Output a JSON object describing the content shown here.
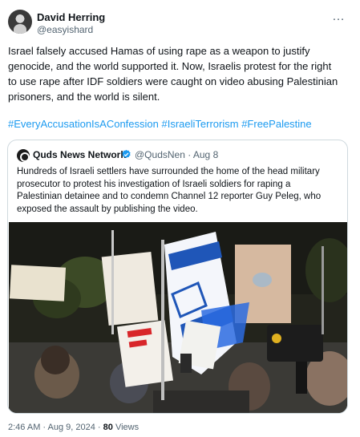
{
  "author": {
    "name": "David Herring",
    "handle": "@easyishard",
    "more_icon": "…"
  },
  "tweet": {
    "lines": [
      "Israel falsely accused Hamas of using rape as a weapon to justify",
      "genocide, and the world supported it. Now, Israelis protest for the right",
      "to use rape after IDF soldiers were caught on video abusing Palestinian",
      "prisoners, and the world is silent."
    ],
    "hashtags": [
      "#EveryAccusationIsAConfession",
      "#IsraeliTerrorism",
      "#FreePalestine"
    ]
  },
  "quote": {
    "name": "Quds News Network",
    "handle_date": "@QudsNen · Aug 8",
    "lines": [
      "Hundreds of Israeli settlers have surrounded the home of the head military",
      "prosecutor to protest his investigation of Israeli soldiers for raping a",
      "Palestinian detainee and to condemn Channel 12 reporter Guy Peleg, who",
      "exposed the assault by publishing the video."
    ],
    "verified_color": "#1d9bf0"
  },
  "meta": {
    "timestamp": "2:46 AM · Aug 9, 2024 · ",
    "views_count": "80",
    "views_label": " Views"
  },
  "colors": {
    "link": "#1d9bf0",
    "secondary_text": "#536471",
    "border": "#cfd9de"
  }
}
